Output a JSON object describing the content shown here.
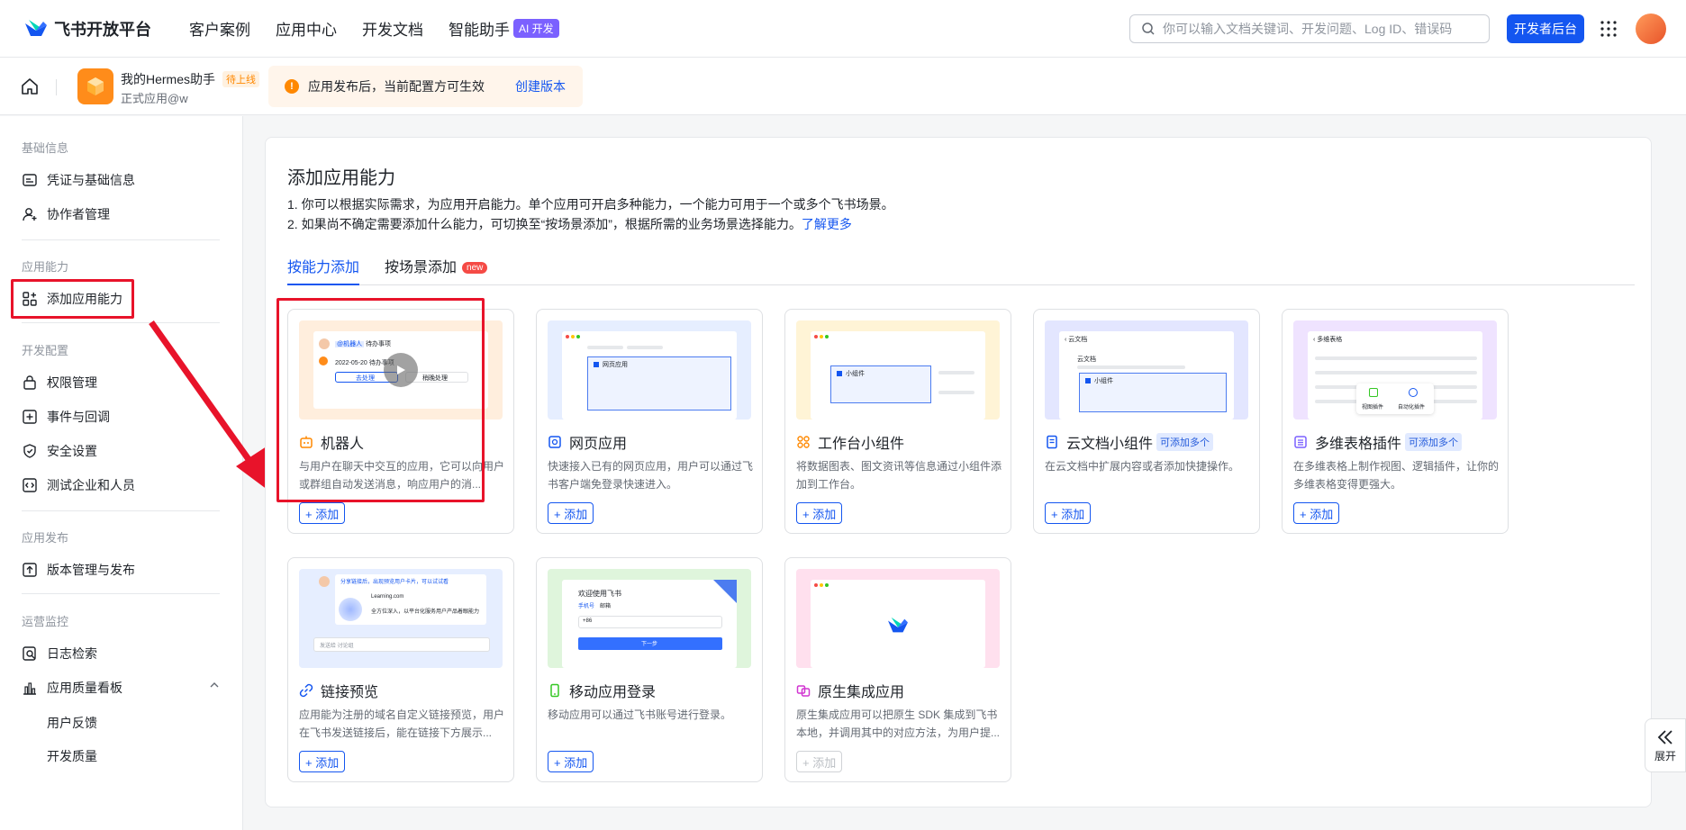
{
  "topnav": {
    "logo_text": "飞书开放平台",
    "links": [
      "客户案例",
      "应用中心",
      "开发文档",
      "智能助手"
    ],
    "ai_badge": "AI 开发",
    "search_placeholder": "你可以输入文档关键词、开发问题、Log ID、错误码",
    "dev_console": "开发者后台"
  },
  "app": {
    "name": "我的Hermes助手",
    "status": "待上线",
    "subtitle": "正式应用@w",
    "notice": "应用发布后，当前配置方可生效",
    "notice_link": "创建版本"
  },
  "sidebar": {
    "sections": [
      "基础信息",
      "应用能力",
      "开发配置",
      "应用发布",
      "运营监控"
    ],
    "items": {
      "credentials": "凭证与基础信息",
      "collaborators": "协作者管理",
      "add_capability": "添加应用能力",
      "permissions": "权限管理",
      "events": "事件与回调",
      "security": "安全设置",
      "test_tenant": "测试企业和人员",
      "version": "版本管理与发布",
      "logs": "日志检索",
      "quality": "应用质量看板",
      "feedback": "用户反馈",
      "dev_quality": "开发质量"
    }
  },
  "main": {
    "title": "添加应用能力",
    "desc1": "1. 你可以根据实际需求，为应用开启能力。单个应用可开启多种能力，一个能力可用于一个或多个飞书场景。",
    "desc2": "2. 如果尚不确定需要添加什么能力，可切换至“按场景添加”，根据所需的业务场景选择能力。",
    "learn_more": "了解更多",
    "tabs": [
      "按能力添加",
      "按场景添加"
    ],
    "new_badge": "new",
    "multi_badge": "可添加多个",
    "add_label": "+ 添加",
    "cards": [
      {
        "title": "机器人",
        "desc": "与用户在聊天中交互的应用，它可以向用户或群组自动发送消息，响应用户的消..."
      },
      {
        "title": "网页应用",
        "desc": "快速接入已有的网页应用，用户可以通过飞书客户端免登录快速进入。"
      },
      {
        "title": "工作台小组件",
        "desc": "将数据图表、图文资讯等信息通过小组件添加到工作台。"
      },
      {
        "title": "云文档小组件",
        "desc": "在云文档中扩展内容或者添加快捷操作。"
      },
      {
        "title": "多维表格插件",
        "desc": "在多维表格上制作视图、逻辑插件，让你的多维表格变得更强大。"
      },
      {
        "title": "链接预览",
        "desc": "应用能为注册的域名自定义链接预览，用户在飞书发送链接后，能在链接下方展示..."
      },
      {
        "title": "移动应用登录",
        "desc": "移动应用可以通过飞书账号进行登录。"
      },
      {
        "title": "原生集成应用",
        "desc": "原生集成应用可以把原生 SDK 集成到飞书本地，并调用其中的对应方法，为用户提..."
      }
    ],
    "previews": {
      "bot_tag": "@机器人",
      "bot_todo": "待办事项",
      "bot_date": "2022-05-20 待办事项",
      "bot_btn1": "去处理",
      "bot_btn2": "稍晚处理",
      "web_label": "网页应用",
      "widget_label": "小组件",
      "doc_header": "云文档",
      "doc_title": "云文档",
      "doc_widget": "小组件",
      "base_header": "多维表格",
      "base_view": "视图插件",
      "base_auto": "自动化插件",
      "link_hint": "分享链接后，出现预览用户卡片，可以试试看",
      "link_domain": "Learning.com",
      "link_text": "全方位深入，以平台化服务用户产品着眼能力",
      "link_input": "发送给 讨论组",
      "mobile_welcome": "欢迎使用飞书",
      "mobile_tab1": "手机号",
      "mobile_tab2": "邮箱",
      "mobile_code": "+86",
      "mobile_next": "下一步"
    }
  },
  "expand": "展开",
  "colors": {
    "brand": "#1456f0",
    "highlight": "#e8132a"
  }
}
